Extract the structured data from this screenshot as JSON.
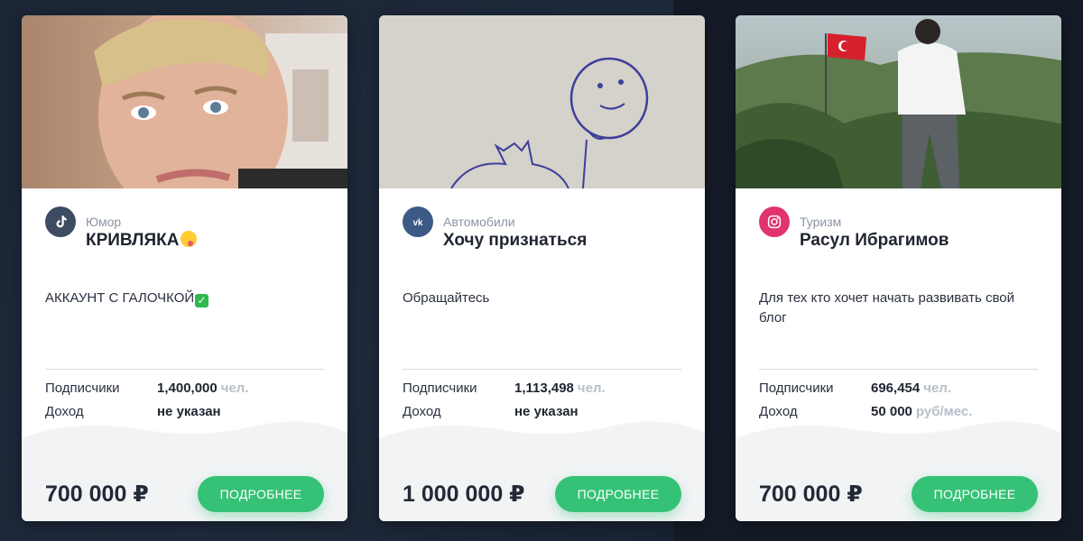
{
  "currency_symbol": "₽",
  "colors": {
    "accent": "#35c276",
    "tiktok": "#3d4b63",
    "vk": "#3d5a86",
    "instagram": "#e0336f"
  },
  "cards": [
    {
      "network_icon": "tiktok-icon",
      "category": "Юмор",
      "name": "КРИВЛЯКА",
      "name_emoji": "zany-face-emoji",
      "description": "АККАУНТ С ГАЛОЧКОЙ",
      "description_emoji": "check-mark-emoji",
      "subscribers_label": "Подписчики",
      "subscribers_value": "1,400,000",
      "subscribers_unit": "чел.",
      "income_label": "Доход",
      "income_value": "не указан",
      "price": "700 000 ₽",
      "button_label": "ПОДРОБНЕЕ"
    },
    {
      "network_icon": "vk-icon",
      "category": "Автомобили",
      "name": "Хочу признаться",
      "description": "Обращайтесь",
      "subscribers_label": "Подписчики",
      "subscribers_value": "1,113,498",
      "subscribers_unit": "чел.",
      "income_label": "Доход",
      "income_value": "не указан",
      "price": "1 000 000 ₽",
      "button_label": "ПОДРОБНЕЕ"
    },
    {
      "network_icon": "instagram-icon",
      "category": "Туризм",
      "name": "Расул Ибрагимов",
      "description": "Для тех кто хочет начать развивать свой блог",
      "subscribers_label": "Подписчики",
      "subscribers_value": "696,454",
      "subscribers_unit": "чел.",
      "income_label": "Доход",
      "income_value": "50 000",
      "income_unit": "руб/мес.",
      "price": "700 000 ₽",
      "button_label": "ПОДРОБНЕЕ"
    }
  ]
}
